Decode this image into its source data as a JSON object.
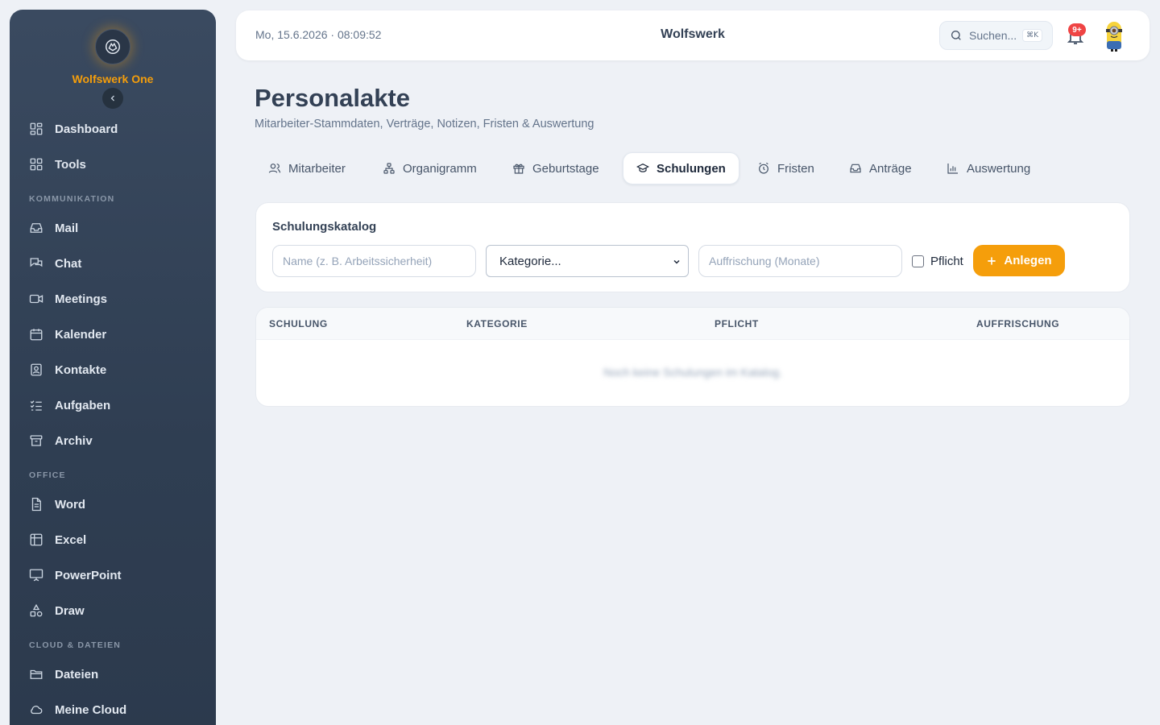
{
  "brand": {
    "name": "Wolfswerk One"
  },
  "sidebar": {
    "top_items": [
      {
        "label": "Dashboard",
        "icon": "grid-icon"
      },
      {
        "label": "Tools",
        "icon": "grid-icon"
      }
    ],
    "sections": [
      {
        "title": "KOMMUNIKATION",
        "items": [
          {
            "label": "Mail",
            "icon": "inbox-icon"
          },
          {
            "label": "Chat",
            "icon": "chat-icon"
          },
          {
            "label": "Meetings",
            "icon": "video-icon"
          },
          {
            "label": "Kalender",
            "icon": "calendar-icon"
          },
          {
            "label": "Kontakte",
            "icon": "contact-icon"
          },
          {
            "label": "Aufgaben",
            "icon": "checklist-icon"
          },
          {
            "label": "Archiv",
            "icon": "archive-icon"
          }
        ]
      },
      {
        "title": "OFFICE",
        "items": [
          {
            "label": "Word",
            "icon": "document-icon"
          },
          {
            "label": "Excel",
            "icon": "table-icon"
          },
          {
            "label": "PowerPoint",
            "icon": "presentation-icon"
          },
          {
            "label": "Draw",
            "icon": "shapes-icon"
          }
        ]
      },
      {
        "title": "CLOUD & DATEIEN",
        "items": [
          {
            "label": "Dateien",
            "icon": "folder-icon"
          },
          {
            "label": "Meine Cloud",
            "icon": "cloud-icon"
          }
        ]
      }
    ]
  },
  "header": {
    "datetime": "Mo, 15.6.2026 · 08:09:52",
    "title": "Wolfswerk",
    "search_placeholder": "Suchen...",
    "search_shortcut": "⌘K",
    "notification_count": "9+"
  },
  "page": {
    "title": "Personalakte",
    "subtitle": "Mitarbeiter-Stammdaten, Verträge, Notizen, Fristen & Auswertung"
  },
  "tabs": [
    {
      "label": "Mitarbeiter",
      "icon": "users-icon",
      "active": false
    },
    {
      "label": "Organigramm",
      "icon": "org-chart-icon",
      "active": false
    },
    {
      "label": "Geburtstage",
      "icon": "gift-icon",
      "active": false
    },
    {
      "label": "Schulungen",
      "icon": "graduation-cap-icon",
      "active": true
    },
    {
      "label": "Fristen",
      "icon": "alarm-icon",
      "active": false
    },
    {
      "label": "Anträge",
      "icon": "inbox-icon",
      "active": false
    },
    {
      "label": "Auswertung",
      "icon": "bar-chart-icon",
      "active": false
    }
  ],
  "catalog_form": {
    "title": "Schulungskatalog",
    "name_placeholder": "Name (z. B. Arbeitssicherheit)",
    "category_selected": "Kategorie...",
    "refresh_placeholder": "Auffrischung (Monate)",
    "mandatory_label": "Pflicht",
    "mandatory_checked": false,
    "submit_label": "Anlegen"
  },
  "catalog_table": {
    "columns": [
      "SCHULUNG",
      "KATEGORIE",
      "PFLICHT",
      "AUFFRISCHUNG"
    ],
    "rows": [],
    "empty_text": "Noch keine Schulungen im Katalog."
  },
  "colors": {
    "accent": "#f59e0b",
    "sidebar_bg": "#334359",
    "page_bg": "#eef1f6",
    "badge": "#ef4444"
  }
}
